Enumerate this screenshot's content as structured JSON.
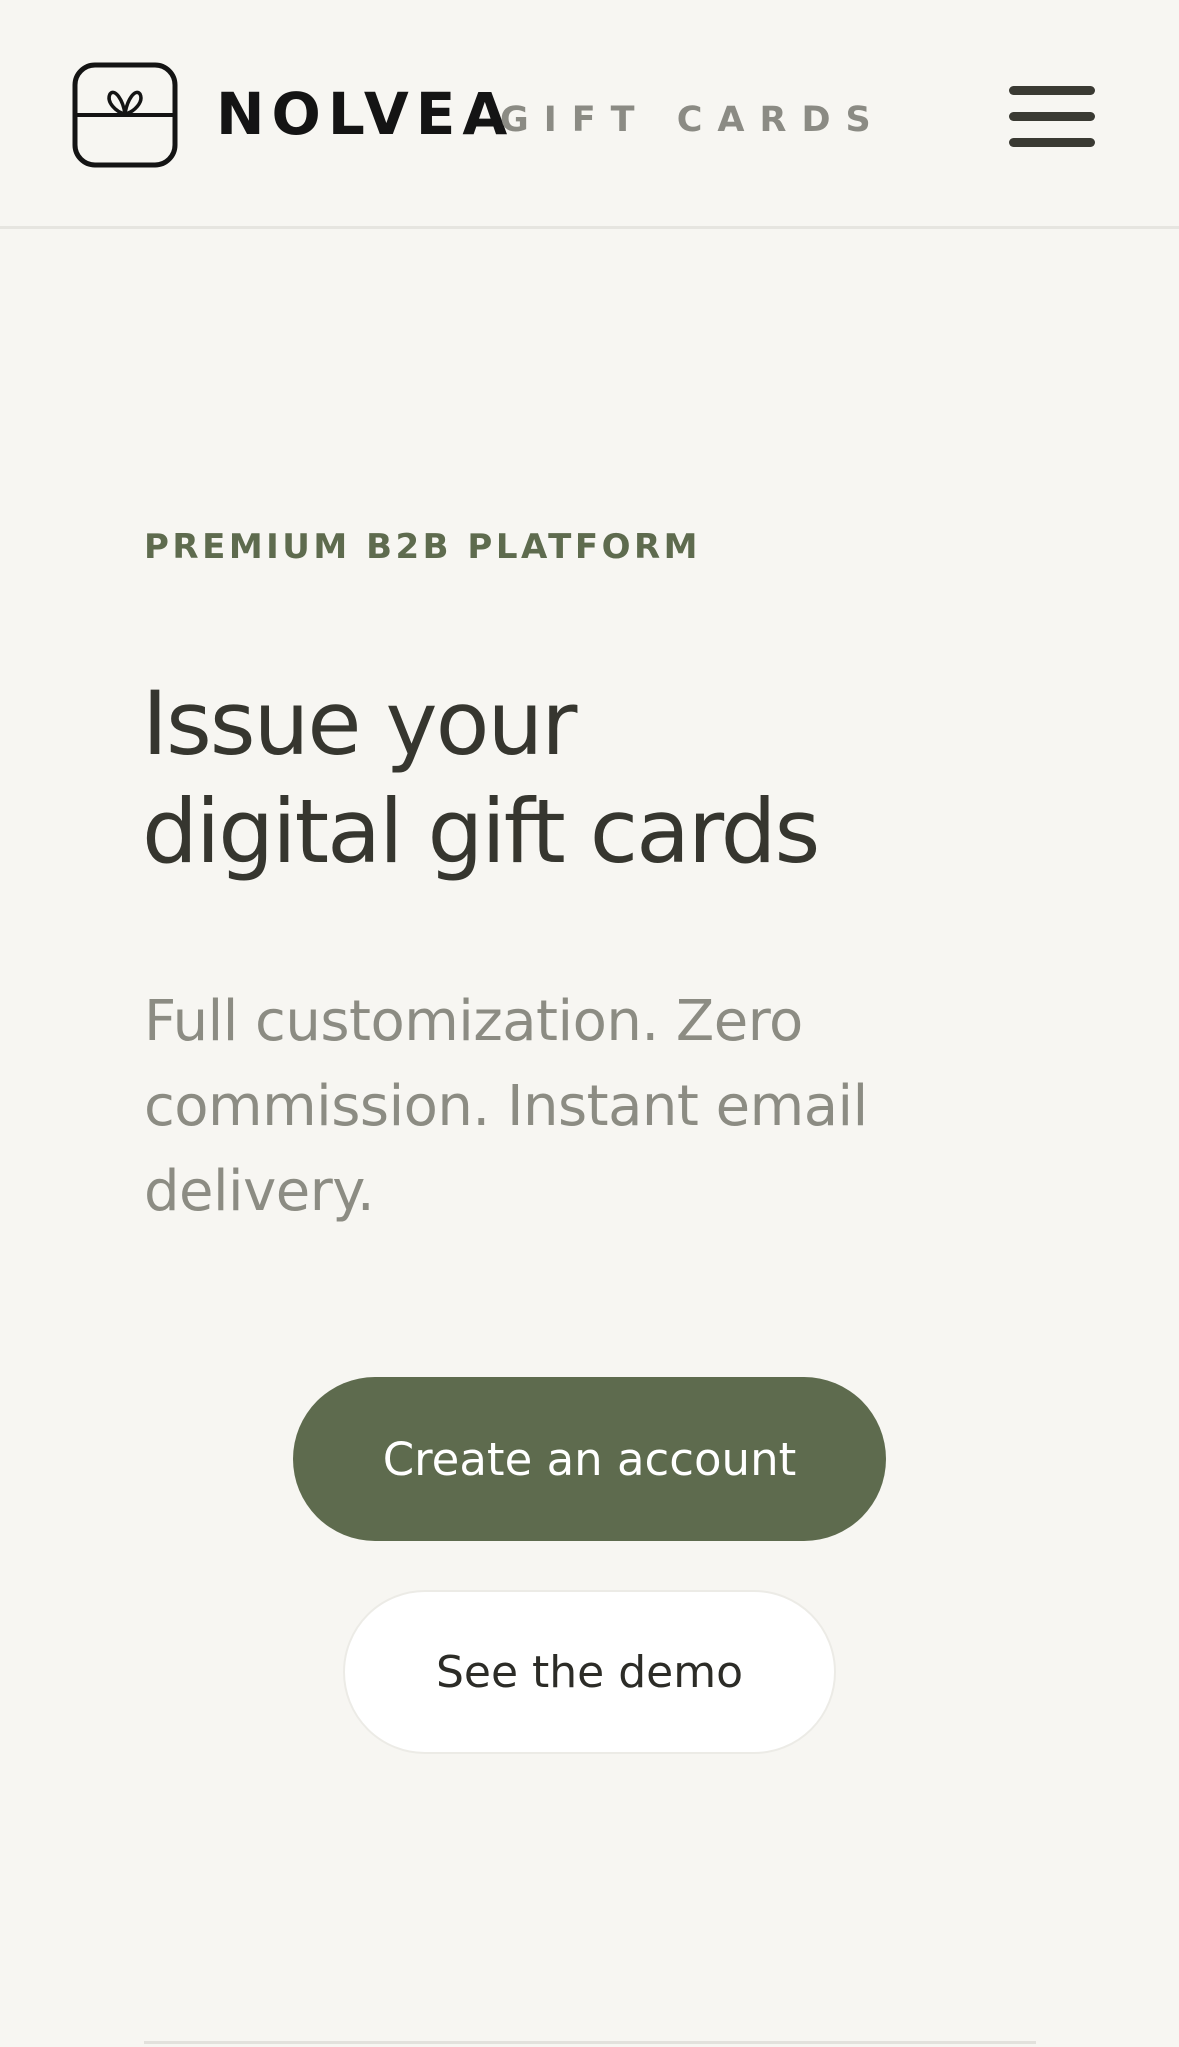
{
  "header": {
    "brand_name": "NOLVEA",
    "brand_sub": "GIFT CARDS",
    "logo_icon": "gift-box-icon",
    "menu_icon": "hamburger-menu-icon"
  },
  "hero": {
    "eyebrow": "PREMIUM B2B PLATFORM",
    "headline_line1": "Issue your",
    "headline_line2": "digital gift cards",
    "subtext": "Full customization. Zero commission. Instant email delivery.",
    "primary_cta": "Create an account",
    "secondary_cta": "See the demo"
  },
  "colors": {
    "background": "#f7f6f2",
    "accent": "#5e6b4e",
    "headline": "#36362f",
    "muted": "#8c8c83"
  }
}
